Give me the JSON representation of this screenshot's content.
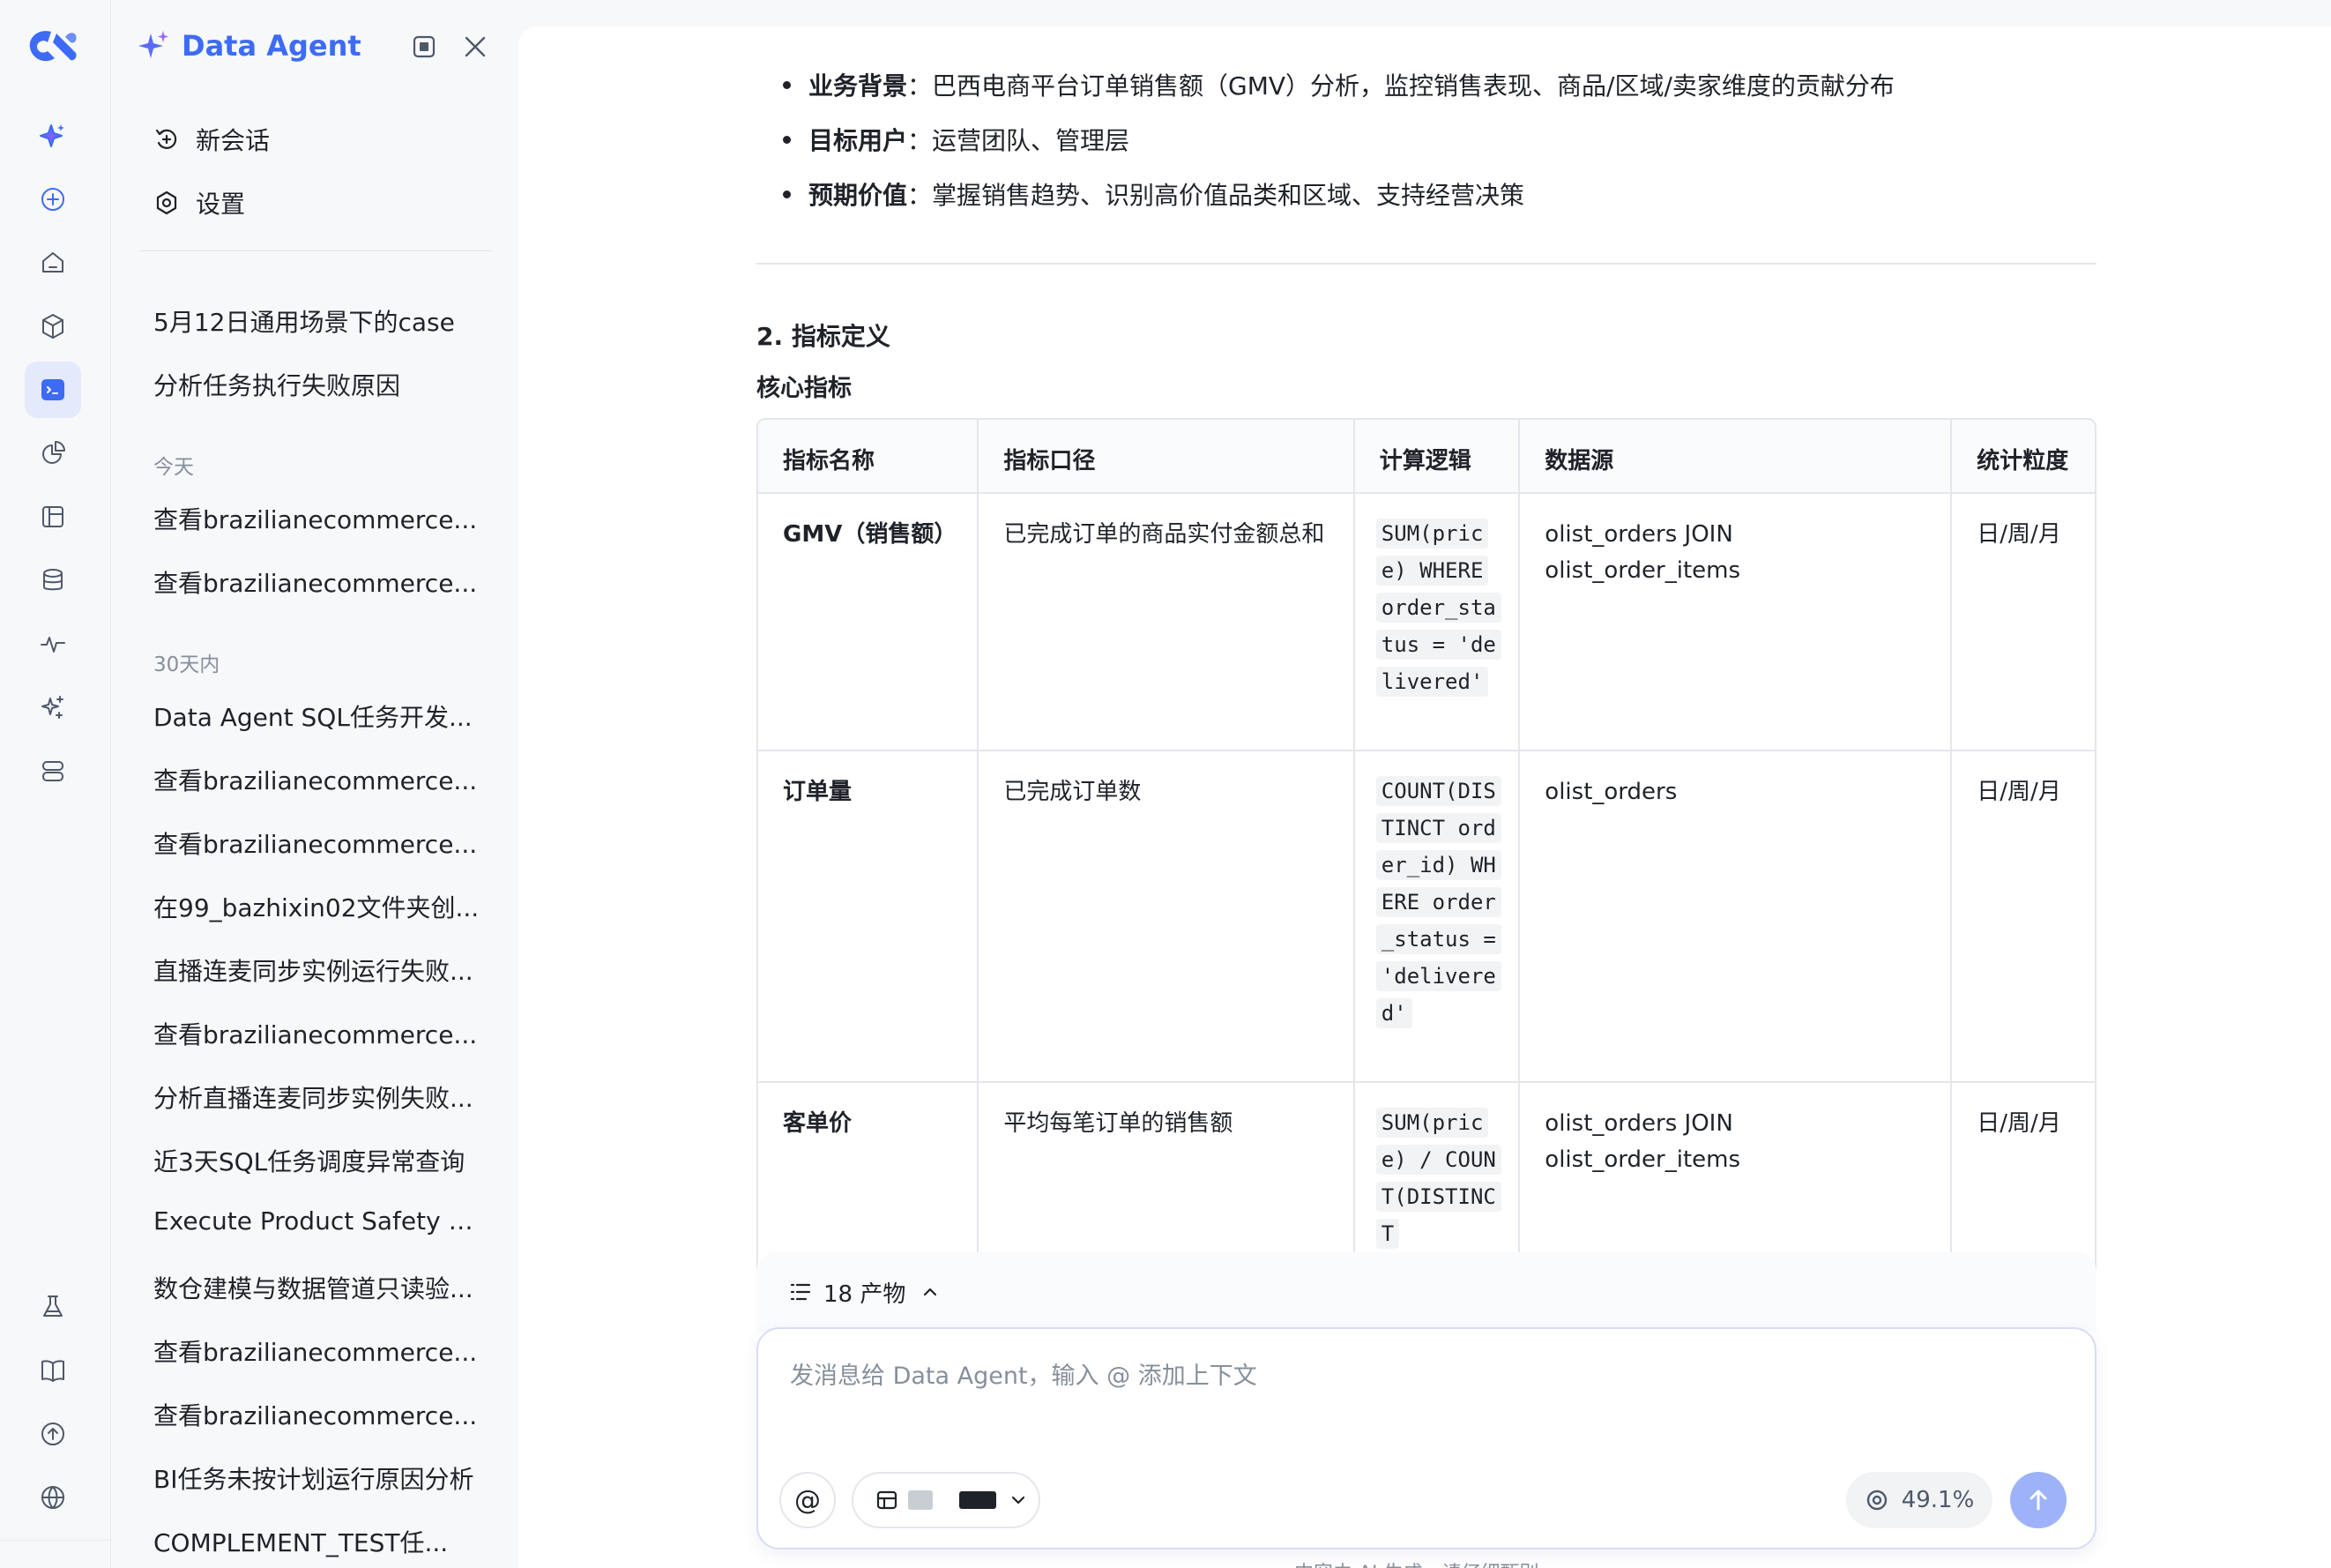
{
  "app": {
    "title": "Data Agent",
    "brand_color": "#3d6bf5"
  },
  "rail": {
    "top_icons": [
      "sparkle-icon",
      "plus-circle-icon",
      "home-icon",
      "cube-icon",
      "terminal-icon",
      "chart-pie-icon",
      "book-open-icon",
      "database-icon",
      "activity-icon",
      "magic-sparkle-icon",
      "server-icon"
    ],
    "active": "terminal-icon",
    "bottom_icons": [
      "flask-icon",
      "book-icon",
      "upload-circle-icon",
      "globe-icon"
    ]
  },
  "sidebar": {
    "actions": [
      {
        "label": "新会话",
        "icon": "new-chat-icon"
      },
      {
        "label": "设置",
        "icon": "settings-icon"
      }
    ],
    "pinned": [
      "5月12日通用场景下的case",
      "分析任务执行失败原因"
    ],
    "groups": [
      {
        "label": "今天",
        "items": [
          "查看brazilianecommerce...",
          "查看brazilianecommerce..."
        ]
      },
      {
        "label": "30天内",
        "items": [
          "Data Agent SQL任务开发...",
          "查看brazilianecommerce...",
          "查看brazilianecommerce...",
          "在99_bazhixin02文件夹创...",
          "直播连麦同步实例运行失败...",
          "查看brazilianecommerce...",
          "分析直播连麦同步实例失败...",
          "近3天SQL任务调度异常查询",
          "Execute Product Safety B...",
          "数仓建模与数据管道只读验...",
          "查看brazilianecommerce...",
          "查看brazilianecommerce...",
          "BI任务未按计划运行原因分析",
          "COMPLEMENT_TEST任..."
        ]
      }
    ]
  },
  "content": {
    "bullets": [
      {
        "label": "业务背景",
        "text": "：巴西电商平台订单销售额（GMV）分析，监控销售表现、商品/区域/卖家维度的贡献分布"
      },
      {
        "label": "目标用户",
        "text": "：运营团队、管理层"
      },
      {
        "label": "预期价值",
        "text": "：掌握销售趋势、识别高价值品类和区域、支持经营决策"
      }
    ],
    "section_title": "2. 指标定义",
    "subsection_title": "核心指标",
    "table": {
      "headers": [
        "指标名称",
        "指标口径",
        "计算逻辑",
        "数据源",
        "统计粒度"
      ],
      "rows": [
        {
          "name": "GMV（销售额）",
          "definition": "已完成订单的商品实付金额总和",
          "logic": "SUM(price) WHERE order_status = 'delivered'",
          "source": "olist_orders JOIN olist_order_items",
          "granularity": "日/周/月"
        },
        {
          "name": "订单量",
          "definition": "已完成订单数",
          "logic": "COUNT(DISTINCT order_id) WHERE order_status = 'delivered'",
          "source": "olist_orders",
          "granularity": "日/周/月"
        },
        {
          "name": "客单价",
          "definition": "平均每笔订单的销售额",
          "logic": "SUM(price) / COUNT(DISTINCT",
          "source": "olist_orders JOIN olist_order_items",
          "granularity": "日/周/月"
        }
      ]
    }
  },
  "composer": {
    "artifacts_label": "18 产物",
    "placeholder": "发消息给 Data Agent，输入 @ 添加上下文",
    "at_label": "@",
    "context_usage": "49.1%",
    "footnote": "内容由 AI 生成，请仔细甄别"
  }
}
